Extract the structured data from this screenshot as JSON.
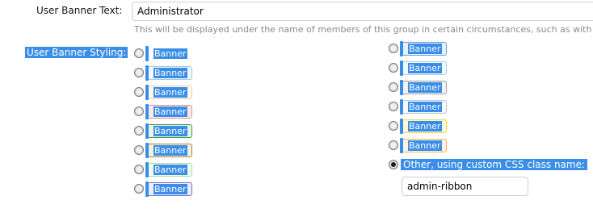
{
  "user_banner_text": {
    "label": "User Banner Text:",
    "value": "Administrator",
    "hint": "This will be displayed under the name of members of this group in certain circumstances, such as with posts."
  },
  "user_banner_styling": {
    "label": "User Banner Styling:",
    "left_options": [
      {
        "label": "Banner",
        "color": "#3a8ee8",
        "border": "#ffffff",
        "bg": "#ffffff"
      },
      {
        "label": "Banner",
        "color": "#3a8ee8",
        "border": "#9ec7ee",
        "bg": "#f4f9fe"
      },
      {
        "label": "Banner",
        "color": "#3a8ee8",
        "border": "#e6d2b0",
        "bg": "#fdf8ef"
      },
      {
        "label": "Banner",
        "color": "#3a8ee8",
        "border": "#e89090",
        "bg": "#fbe9e9"
      },
      {
        "label": "Banner",
        "color": "#3a8ee8",
        "border": "#3b9c3b",
        "bg": "#e6f5e6"
      },
      {
        "label": "Banner",
        "color": "#3a8ee8",
        "border": "#a08a3a",
        "bg": "#f5f0dc"
      },
      {
        "label": "Banner",
        "color": "#3a8ee8",
        "border": "#a8e0a8",
        "bg": "#eefaee"
      },
      {
        "label": "Banner",
        "color": "#3a8ee8",
        "border": "#7070d8",
        "bg": "#ececfb"
      }
    ],
    "right_options": [
      {
        "label": "Banner",
        "color": "#3a8ee8",
        "border": "#6aa0e0",
        "bg": "#e8f1fc"
      },
      {
        "label": "Banner",
        "color": "#3a8ee8",
        "border": "#9fd0e8",
        "bg": "#f3fafd"
      },
      {
        "label": "Banner",
        "color": "#3a8ee8",
        "border": "#a0a0a0",
        "bg": "#f2f2f2"
      },
      {
        "label": "Banner",
        "color": "#3a8ee8",
        "border": "#b8c8dc",
        "bg": "#f6f9fc"
      },
      {
        "label": "Banner",
        "color": "#3a8ee8",
        "border": "#e8d840",
        "bg": "#fcf8d0"
      },
      {
        "label": "Banner",
        "color": "#3a8ee8",
        "border": "#e8b860",
        "bg": "#fdf3e0"
      }
    ],
    "other_option": {
      "label": "Other, using custom CSS class name:",
      "value": "admin-ribbon",
      "checked": true
    }
  },
  "colors": {
    "highlight": "#3a8ee8",
    "hint_text": "#8a8a8a"
  }
}
